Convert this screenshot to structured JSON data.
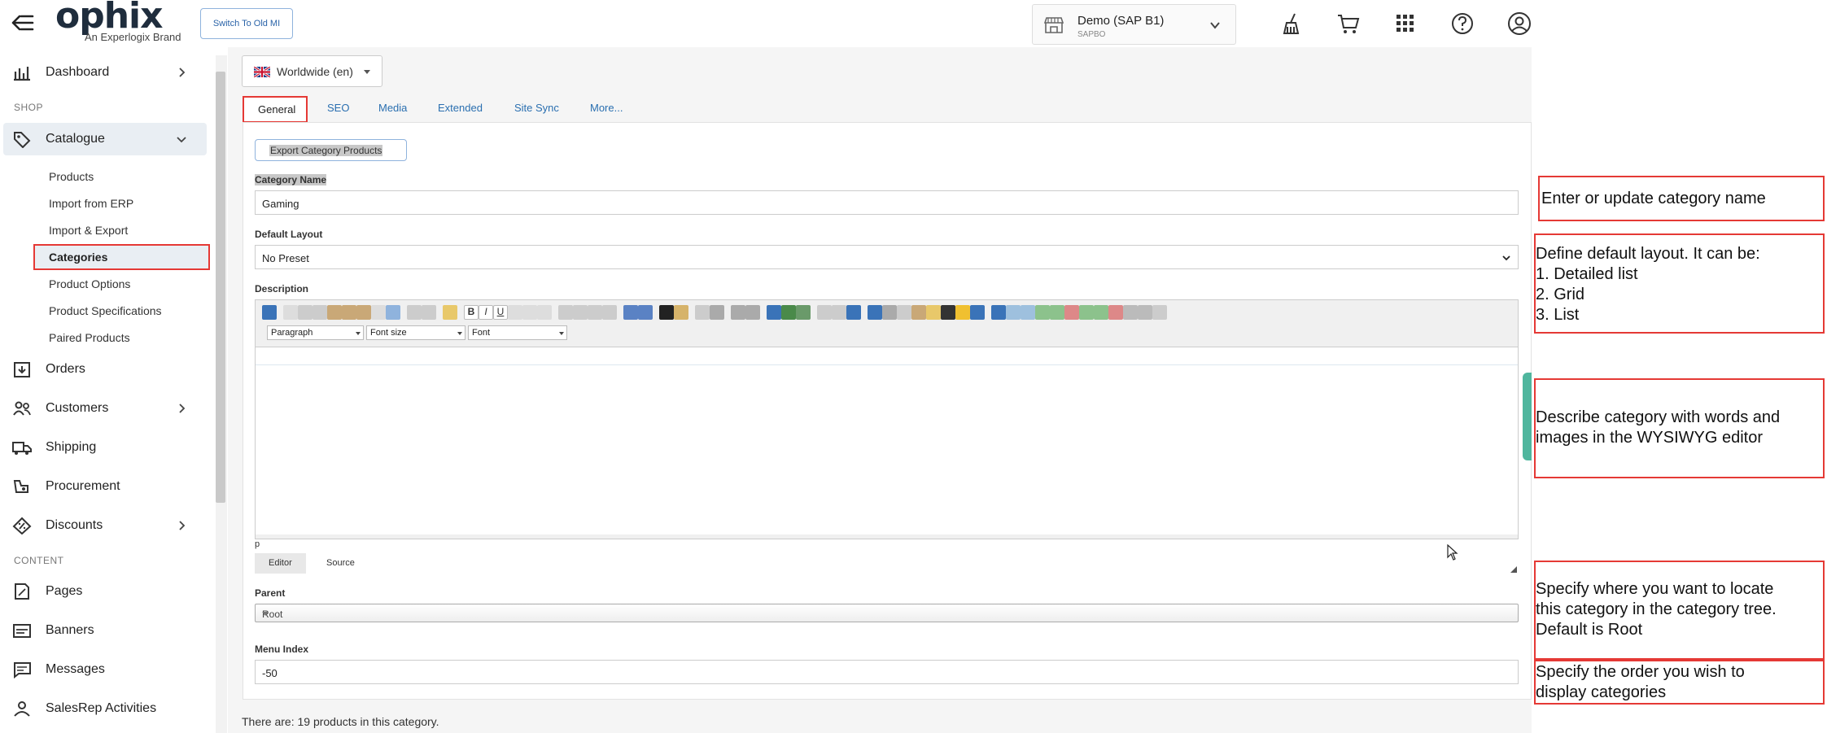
{
  "header": {
    "logo_word": "ophix",
    "logo_tag": "An Experlogix Brand",
    "switch_button": "Switch To Old MI",
    "company_name": "Demo (SAP B1)",
    "company_sub": "SAPBO"
  },
  "sidebar": {
    "dashboard": "Dashboard",
    "section_shop": "SHOP",
    "catalogue": "Catalogue",
    "catalogue_items": [
      "Products",
      "Import from ERP",
      "Import & Export",
      "Categories",
      "Product Options",
      "Product Specifications",
      "Paired Products"
    ],
    "orders": "Orders",
    "customers": "Customers",
    "shipping": "Shipping",
    "procurement": "Procurement",
    "discounts": "Discounts",
    "section_content": "CONTENT",
    "pages": "Pages",
    "banners": "Banners",
    "messages": "Messages",
    "salesrep": "SalesRep Activities"
  },
  "main": {
    "language": "Worldwide (en)",
    "tabs": [
      "General",
      "SEO",
      "Media",
      "Extended",
      "Site Sync",
      "More..."
    ],
    "export_button": "Export Category Products",
    "category_name_label": "Category Name",
    "category_name_value": "Gaming",
    "default_layout_label": "Default Layout",
    "default_layout_value": "No Preset",
    "description_label": "Description",
    "editor_paragraph": "Paragraph",
    "editor_font_size": "Font size",
    "editor_font": "Font",
    "editor_path": "p",
    "editor_tab_editor": "Editor",
    "editor_tab_source": "Source",
    "parent_label": "Parent",
    "parent_value": "Root",
    "menu_index_label": "Menu Index",
    "menu_index_value": "-50",
    "footer": "There are: 19 products in this category."
  },
  "annotations": {
    "category_name": "Enter or update category name",
    "layout": "Define default layout. It can be:\n1. Detailed list\n2. Grid\n3. List",
    "description": "Describe category with words and\nimages in the WYSIWYG editor",
    "parent": "Specify where you want to locate\nthis category in the category tree.\nDefault is Root",
    "menu_index": "Specify the order you wish to\ndisplay categories"
  }
}
